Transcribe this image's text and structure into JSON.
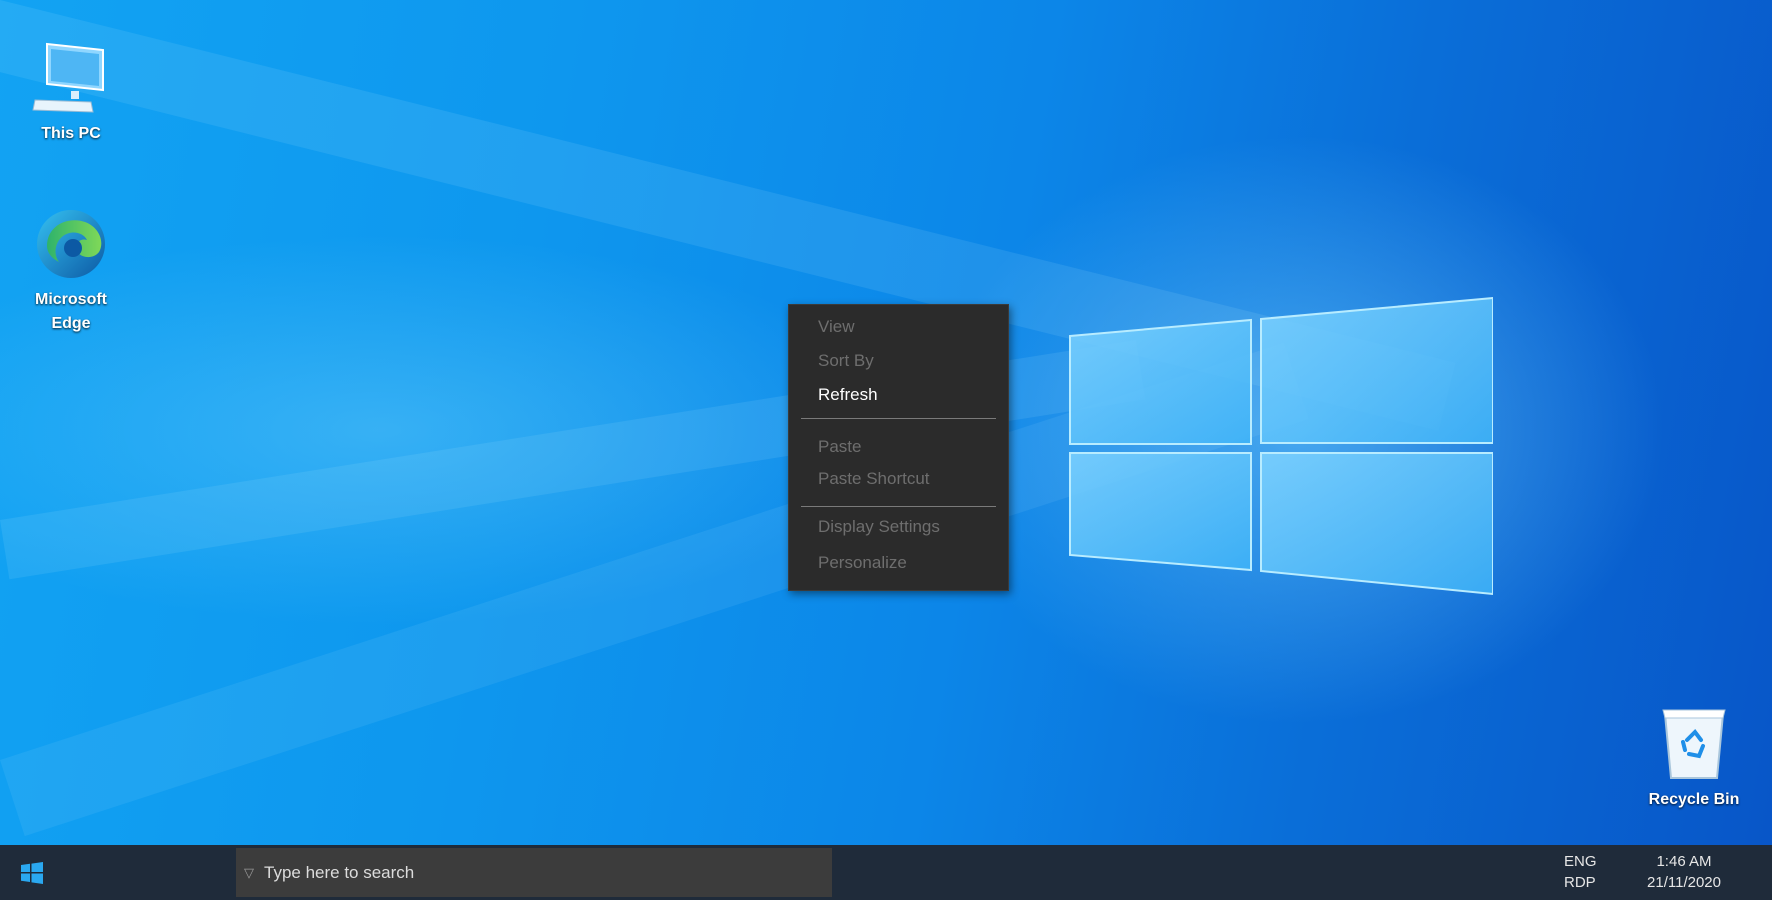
{
  "desktop": {
    "icons": [
      {
        "label": "This PC"
      },
      {
        "label": "Microsoft Edge"
      },
      {
        "label": "Recycle Bin"
      }
    ]
  },
  "context_menu": {
    "items": [
      {
        "label": "View",
        "enabled": false
      },
      {
        "label": "Sort By",
        "enabled": false
      },
      {
        "label": "Refresh",
        "enabled": true
      },
      {
        "label": "Paste",
        "enabled": false
      },
      {
        "label": "Paste Shortcut",
        "enabled": false
      },
      {
        "label": "Display Settings",
        "enabled": false
      },
      {
        "label": "Personalize",
        "enabled": false
      }
    ]
  },
  "taskbar": {
    "search_placeholder": "Type here to search",
    "language": {
      "line1": "ENG",
      "line2": "RDP"
    },
    "clock": {
      "time": "1:46 AM",
      "date": "21/11/2020"
    }
  },
  "colors": {
    "wallpaper_blue": "#0e97ee",
    "menu_background": "#2b2b2b",
    "taskbar_background": "#1f2b3a",
    "search_background": "#3c3c3c"
  },
  "icons": [
    "this-pc-icon",
    "edge-icon",
    "recycle-bin-icon",
    "windows-start-icon",
    "search-icon",
    "windows-wallpaper-logo"
  ]
}
